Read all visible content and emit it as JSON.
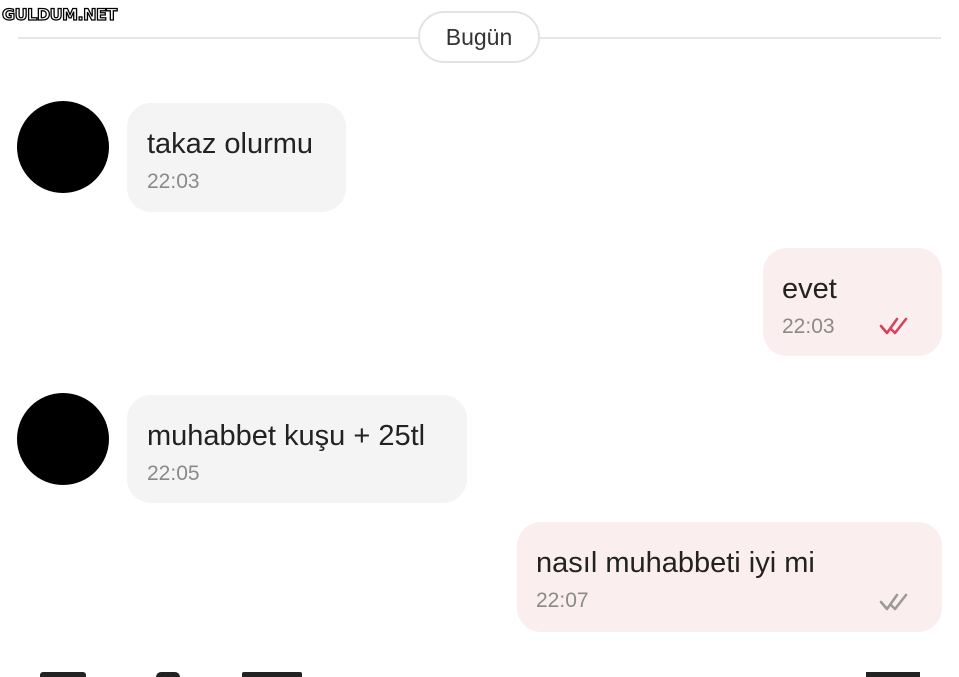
{
  "watermark": "GULDUM.NET",
  "date_separator": "Bugün",
  "messages": [
    {
      "direction": "incoming",
      "text": "takaz olurmu",
      "time": "22:03"
    },
    {
      "direction": "outgoing",
      "text": "evet",
      "time": "22:03",
      "status": "read"
    },
    {
      "direction": "incoming",
      "text": "muhabbet kuşu + 25tl",
      "time": "22:05"
    },
    {
      "direction": "outgoing",
      "text": "nasıl muhabbeti iyi mi",
      "time": "22:07",
      "status": "delivered"
    }
  ],
  "colors": {
    "incoming_bubble": "#f4f4f4",
    "outgoing_bubble": "#fbeeee",
    "read_ticks": "#d9405a",
    "delivered_ticks": "#9a9a9a",
    "avatar": "#000000"
  },
  "icons": {
    "read": "double-check-icon",
    "delivered": "double-check-icon"
  }
}
